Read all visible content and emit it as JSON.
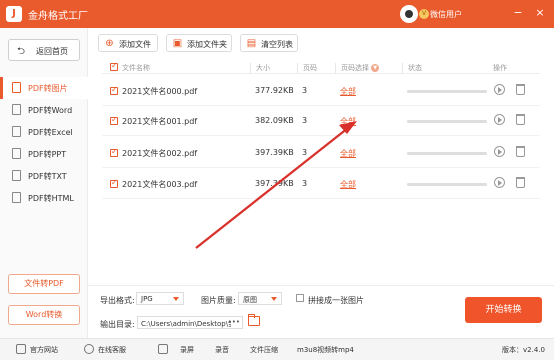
{
  "app": {
    "title": "金舟格式工厂",
    "logo": "J",
    "user_name": "微信用户",
    "vip": "V"
  },
  "window": {
    "minimize": "−",
    "close": "×"
  },
  "sidebar": {
    "home_label": "返回首页",
    "items": [
      {
        "label": "PDF转图片",
        "active": true
      },
      {
        "label": "PDF转Word"
      },
      {
        "label": "PDF转Excel"
      },
      {
        "label": "PDF转PPT"
      },
      {
        "label": "PDF转TXT"
      },
      {
        "label": "PDF转HTML"
      }
    ],
    "bottom_buttons": [
      "文件转PDF",
      "Word转换"
    ]
  },
  "toolbar": {
    "add_file": "添加文件",
    "add_folder": "添加文件夹",
    "clear_list": "清空列表"
  },
  "table": {
    "headers": {
      "name": "文件名称",
      "size": "大小",
      "pages": "页码",
      "page_select": "页码选择",
      "status": "状态",
      "actions": "操作"
    },
    "rows": [
      {
        "name": "2021文件名000.pdf",
        "size": "377.92KB",
        "pages": "3",
        "range": "全部"
      },
      {
        "name": "2021文件名001.pdf",
        "size": "382.09KB",
        "pages": "3",
        "range": "全部"
      },
      {
        "name": "2021文件名002.pdf",
        "size": "397.39KB",
        "pages": "3",
        "range": "全部"
      },
      {
        "name": "2021文件名003.pdf",
        "size": "397.39KB",
        "pages": "3",
        "range": "全部"
      }
    ]
  },
  "options": {
    "format_label": "导出格式:",
    "format_value": "JPG",
    "quality_label": "图片质量:",
    "quality_value": "原图",
    "merge_label": "拼接成一张图片",
    "output_label": "输出目录:",
    "output_path": "C:\\Users\\admin\\Desktop\\金",
    "more": "•••",
    "start_label": "开始转换"
  },
  "statusbar": {
    "website": "官方网站",
    "consult": "在线客服",
    "record_screen": "录屏",
    "record_audio": "录音",
    "compress": "文件压缩",
    "convert": "m3u8视频转mp4",
    "version": "版本：v2.4.0"
  },
  "colors": {
    "accent": "#e95a2c",
    "annotation_arrow": "#d9302a"
  }
}
